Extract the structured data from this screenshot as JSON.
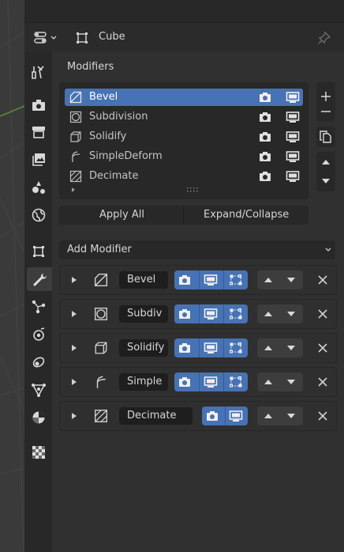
{
  "header": {
    "object_name": "Cube"
  },
  "modifiers_panel": {
    "title": "Modifiers",
    "stack_items": [
      {
        "label": "Bevel",
        "icon": "bevel-icon",
        "selected": true
      },
      {
        "label": "Subdivision",
        "icon": "subdivision-icon",
        "selected": false
      },
      {
        "label": "Solidify",
        "icon": "solidify-icon",
        "selected": false
      },
      {
        "label": "SimpleDeform",
        "icon": "simpledeform-icon",
        "selected": false
      },
      {
        "label": "Decimate",
        "icon": "decimate-icon",
        "selected": false
      }
    ],
    "apply_all_label": "Apply All",
    "expand_collapse_label": "Expand/Collapse",
    "add_modifier_label": "Add Modifier"
  },
  "modifier_cards": [
    {
      "name": "Bevel",
      "icon": "bevel-icon",
      "has_editmode": true
    },
    {
      "name": "Subdiv",
      "icon": "subdivision-icon",
      "has_editmode": true
    },
    {
      "name": "Solidify",
      "icon": "solidify-icon",
      "has_editmode": true
    },
    {
      "name": "Simple",
      "icon": "simpledeform-icon",
      "has_editmode": true
    },
    {
      "name": "Decimate",
      "icon": "decimate-icon",
      "has_editmode": false
    }
  ],
  "properties_tabs": [
    "tool-icon",
    "render-icon",
    "output-icon",
    "view-layer-icon",
    "scene-icon",
    "world-icon",
    "object-icon",
    "modifier-icon",
    "particles-icon",
    "physics-icon",
    "constraints-icon",
    "data-icon",
    "material-icon",
    "texture-icon"
  ],
  "colors": {
    "accent": "#4772b3",
    "panel_bg": "#303030",
    "field_bg": "#1e1e1e"
  }
}
